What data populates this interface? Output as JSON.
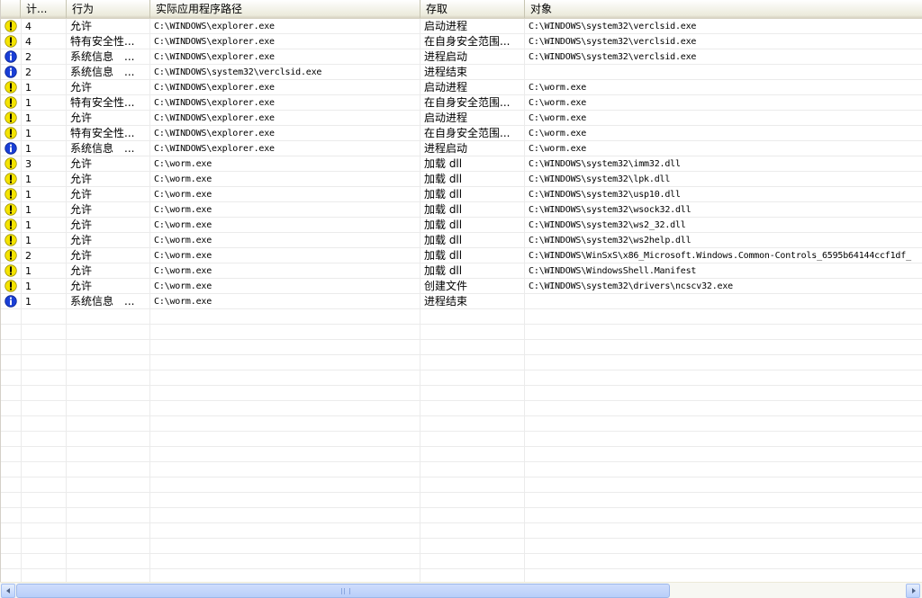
{
  "columns": [
    "计...",
    "行为",
    "实际应用程序路径",
    "存取",
    "对象"
  ],
  "rows": [
    {
      "icon": "warning",
      "count": "4",
      "behavior": "允许",
      "path": "C:\\WINDOWS\\explorer.exe",
      "access": "启动进程",
      "target": "C:\\WINDOWS\\system32\\verclsid.exe"
    },
    {
      "icon": "warning",
      "count": "4",
      "behavior": "特有安全性...",
      "path": "C:\\WINDOWS\\explorer.exe",
      "access": "在自身安全范围...",
      "target": "C:\\WINDOWS\\system32\\verclsid.exe"
    },
    {
      "icon": "info",
      "count": "2",
      "behavior": "系统信息　...",
      "path": "C:\\WINDOWS\\explorer.exe",
      "access": "进程启动",
      "target": "C:\\WINDOWS\\system32\\verclsid.exe"
    },
    {
      "icon": "info",
      "count": "2",
      "behavior": "系统信息　...",
      "path": "C:\\WINDOWS\\system32\\verclsid.exe",
      "access": "进程结束",
      "target": ""
    },
    {
      "icon": "warning",
      "count": "1",
      "behavior": "允许",
      "path": "C:\\WINDOWS\\explorer.exe",
      "access": "启动进程",
      "target": "C:\\worm.exe"
    },
    {
      "icon": "warning",
      "count": "1",
      "behavior": "特有安全性...",
      "path": "C:\\WINDOWS\\explorer.exe",
      "access": "在自身安全范围...",
      "target": "C:\\worm.exe"
    },
    {
      "icon": "warning",
      "count": "1",
      "behavior": "允许",
      "path": "C:\\WINDOWS\\explorer.exe",
      "access": "启动进程",
      "target": "C:\\worm.exe"
    },
    {
      "icon": "warning",
      "count": "1",
      "behavior": "特有安全性...",
      "path": "C:\\WINDOWS\\explorer.exe",
      "access": "在自身安全范围...",
      "target": "C:\\worm.exe"
    },
    {
      "icon": "info",
      "count": "1",
      "behavior": "系统信息　...",
      "path": "C:\\WINDOWS\\explorer.exe",
      "access": "进程启动",
      "target": "C:\\worm.exe"
    },
    {
      "icon": "warning",
      "count": "3",
      "behavior": "允许",
      "path": "C:\\worm.exe",
      "access": "加载 dll",
      "target": "C:\\WINDOWS\\system32\\imm32.dll"
    },
    {
      "icon": "warning",
      "count": "1",
      "behavior": "允许",
      "path": "C:\\worm.exe",
      "access": "加载 dll",
      "target": "C:\\WINDOWS\\system32\\lpk.dll"
    },
    {
      "icon": "warning",
      "count": "1",
      "behavior": "允许",
      "path": "C:\\worm.exe",
      "access": "加载 dll",
      "target": "C:\\WINDOWS\\system32\\usp10.dll"
    },
    {
      "icon": "warning",
      "count": "1",
      "behavior": "允许",
      "path": "C:\\worm.exe",
      "access": "加载 dll",
      "target": "C:\\WINDOWS\\system32\\wsock32.dll"
    },
    {
      "icon": "warning",
      "count": "1",
      "behavior": "允许",
      "path": "C:\\worm.exe",
      "access": "加载 dll",
      "target": "C:\\WINDOWS\\system32\\ws2_32.dll"
    },
    {
      "icon": "warning",
      "count": "1",
      "behavior": "允许",
      "path": "C:\\worm.exe",
      "access": "加载 dll",
      "target": "C:\\WINDOWS\\system32\\ws2help.dll"
    },
    {
      "icon": "warning",
      "count": "2",
      "behavior": "允许",
      "path": "C:\\worm.exe",
      "access": "加载 dll",
      "target": "C:\\WINDOWS\\WinSxS\\x86_Microsoft.Windows.Common-Controls_6595b64144ccf1df_"
    },
    {
      "icon": "warning",
      "count": "1",
      "behavior": "允许",
      "path": "C:\\worm.exe",
      "access": "加载 dll",
      "target": "C:\\WINDOWS\\WindowsShell.Manifest"
    },
    {
      "icon": "warning",
      "count": "1",
      "behavior": "允许",
      "path": "C:\\worm.exe",
      "access": "创建文件",
      "target": "C:\\WINDOWS\\system32\\drivers\\ncscv32.exe"
    },
    {
      "icon": "info",
      "count": "1",
      "behavior": "系统信息　...",
      "path": "C:\\worm.exe",
      "access": "进程结束",
      "target": ""
    }
  ],
  "colors": {
    "warning_fill": "#f5e400",
    "info_fill": "#1a3fd6",
    "header_bg": "#ebeadb"
  }
}
